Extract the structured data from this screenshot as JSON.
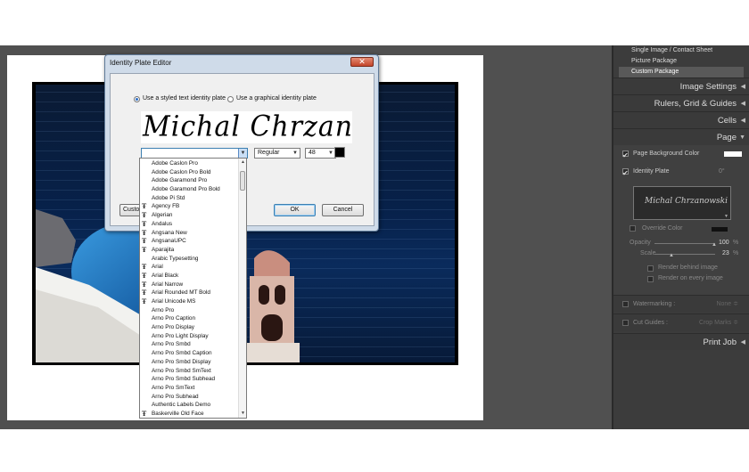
{
  "right_panel": {
    "layout_items": [
      "Single Image / Contact Sheet",
      "Picture Package",
      "Custom Package"
    ],
    "sections": {
      "image_settings": "Image Settings",
      "rulers": "Rulers, Grid & Guides",
      "cells": "Cells",
      "page": "Page",
      "print_job": "Print Job"
    },
    "page_background_color": "Page Background Color",
    "identity_plate": "Identity Plate",
    "identity_plate_angle": "0°",
    "identity_plate_preview": "Michal Chrzanowski",
    "override_color": "Override Color",
    "opacity_label": "Opacity",
    "opacity_value": "100",
    "opacity_unit": "%",
    "scale_label": "Scale",
    "scale_value": "23",
    "scale_unit": "%",
    "render_behind": "Render behind image",
    "render_every": "Render on every image",
    "watermarking": "Watermarking :",
    "watermark_value": "None ≑",
    "cut_guides": "Cut Guides :",
    "cut_guides_value": "Crop Marks ≑"
  },
  "dialog": {
    "title": "Identity Plate Editor",
    "radio_styled": "Use a styled text identity plate",
    "radio_graphical": "Use a graphical identity plate",
    "preview_text": "Michal Chrzanows",
    "font_style": "Regular",
    "font_size": "48",
    "custom_button": "Custo",
    "ok": "OK",
    "cancel": "Cancel"
  },
  "font_list": [
    {
      "name": "Adobe Caslon Pro",
      "tt": false
    },
    {
      "name": "Adobe Caslon Pro Bold",
      "tt": false
    },
    {
      "name": "Adobe Garamond Pro",
      "tt": false
    },
    {
      "name": "Adobe Garamond Pro Bold",
      "tt": false
    },
    {
      "name": "Adobe Pi Std",
      "tt": false
    },
    {
      "name": "Agency FB",
      "tt": true
    },
    {
      "name": "Algerian",
      "tt": true
    },
    {
      "name": "Andalus",
      "tt": true
    },
    {
      "name": "Angsana New",
      "tt": true
    },
    {
      "name": "AngsanaUPC",
      "tt": true
    },
    {
      "name": "Aparajita",
      "tt": true
    },
    {
      "name": "Arabic Typesetting",
      "tt": false
    },
    {
      "name": "Arial",
      "tt": true
    },
    {
      "name": "Arial Black",
      "tt": true
    },
    {
      "name": "Arial Narrow",
      "tt": true
    },
    {
      "name": "Arial Rounded MT Bold",
      "tt": true
    },
    {
      "name": "Arial Unicode MS",
      "tt": true
    },
    {
      "name": "Arno Pro",
      "tt": false
    },
    {
      "name": "Arno Pro Caption",
      "tt": false
    },
    {
      "name": "Arno Pro Display",
      "tt": false
    },
    {
      "name": "Arno Pro Light Display",
      "tt": false
    },
    {
      "name": "Arno Pro Smbd",
      "tt": false
    },
    {
      "name": "Arno Pro Smbd Caption",
      "tt": false
    },
    {
      "name": "Arno Pro Smbd Display",
      "tt": false
    },
    {
      "name": "Arno Pro Smbd SmText",
      "tt": false
    },
    {
      "name": "Arno Pro Smbd Subhead",
      "tt": false
    },
    {
      "name": "Arno Pro SmText",
      "tt": false
    },
    {
      "name": "Arno Pro Subhead",
      "tt": false
    },
    {
      "name": "Authentic Labels Demo",
      "tt": false
    },
    {
      "name": "Baskerville Old Face",
      "tt": true
    }
  ],
  "colors": {
    "panel_bg": "#3c3c3c",
    "app_bg": "#505050",
    "dialog_frame": "#cfdbe9",
    "sea": "#07214a",
    "dome": "#1e6fb8"
  }
}
